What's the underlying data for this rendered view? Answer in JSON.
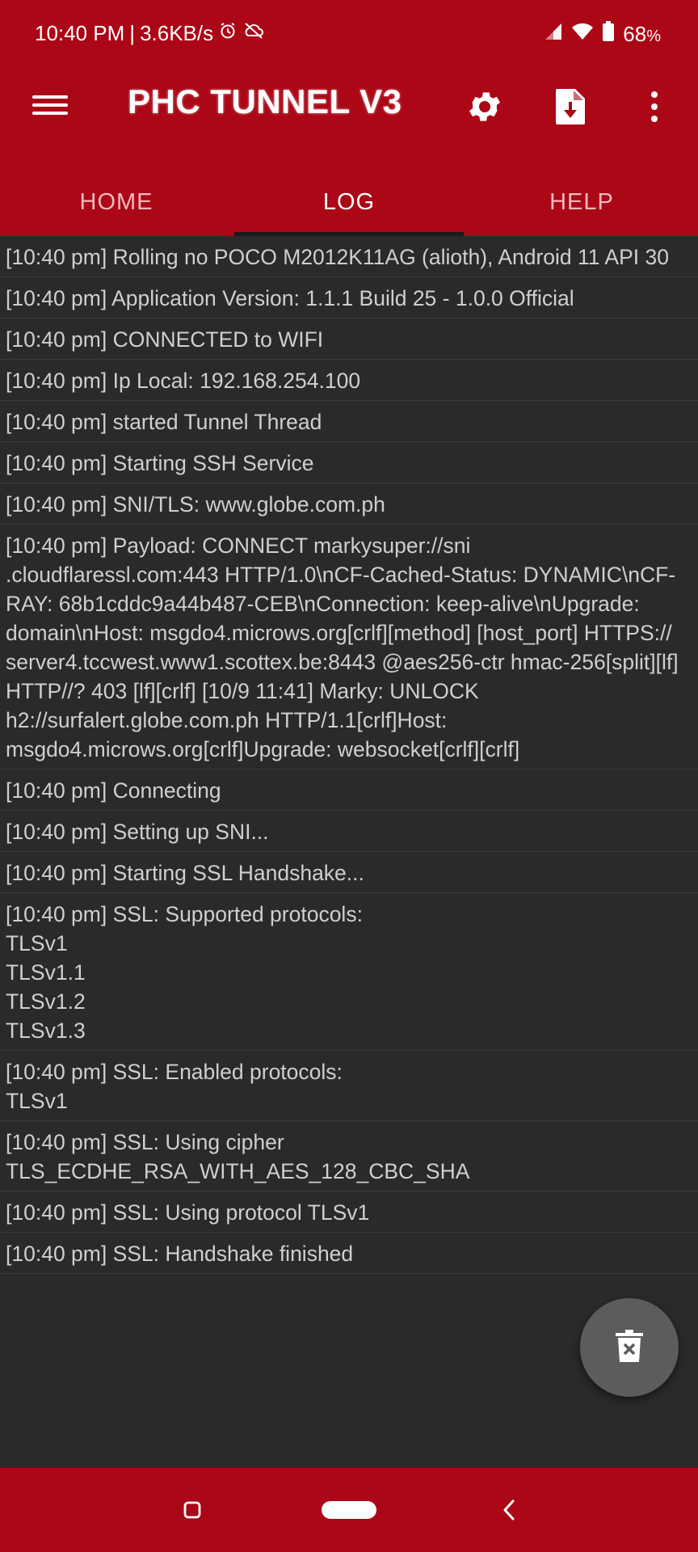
{
  "status_bar": {
    "time": "10:40 PM",
    "speed": "3.6KB/s",
    "battery": "68",
    "battery_unit": "%"
  },
  "app_bar": {
    "title": "PHC TUNNEL V3",
    "icons": [
      "menu-icon",
      "gear-icon",
      "file-import-icon",
      "more-vert-icon"
    ]
  },
  "tabs": [
    {
      "label": "HOME",
      "active": false
    },
    {
      "label": "LOG",
      "active": true
    },
    {
      "label": "HELP",
      "active": false
    }
  ],
  "log": [
    "[10:40 pm] Rolling no POCO M2012K11AG (alioth), Android 11 API 30",
    "[10:40 pm] Application Version: 1.1.1 Build 25 - 1.0.0 Official",
    "[10:40 pm] CONNECTED to WIFI",
    "[10:40 pm] Ip Local: 192.168.254.100",
    "[10:40 pm] started Tunnel Thread",
    "[10:40 pm] Starting SSH Service",
    "[10:40 pm] SNI/TLS: www.globe.com.ph",
    "[10:40 pm] Payload: CONNECT markysuper://sni\n.cloudflaressl.com:443 HTTP/1.0\\nCF-Cached-Status: DYNAMIC\\nCF-RAY: 68b1cddc9a44b487-CEB\\nConnection: keep-alive\\nUpgrade: domain\\nHost: msgdo4.microws.org[crlf][method] [host_port] HTTPS:// server4.tccwest.www1.scottex.be:8443 @aes256-ctr hmac-256[split][lf] HTTP//? 403 [lf][crlf] [10/9 11:41] Marky: UNLOCK h2://surfalert.globe.com.ph HTTP/1.1[crlf]Host: msgdo4.microws.org[crlf]Upgrade: websocket[crlf][crlf]",
    "[10:40 pm] Connecting",
    "[10:40 pm] Setting up SNI...",
    "[10:40 pm] Starting SSL Handshake...",
    "[10:40 pm] SSL: Supported protocols:\nTLSv1\nTLSv1.1\nTLSv1.2\nTLSv1.3",
    "[10:40 pm] SSL: Enabled protocols:\nTLSv1",
    "[10:40 pm] SSL: Using cipher\nTLS_ECDHE_RSA_WITH_AES_128_CBC_SHA",
    "[10:40 pm] SSL: Using protocol TLSv1",
    "[10:40 pm] SSL: Handshake finished"
  ],
  "fab": {
    "icon": "delete-icon"
  },
  "nav": {
    "icons": [
      "recents-icon",
      "home-pill-icon",
      "back-icon"
    ]
  },
  "colors": {
    "primary": "#ab0716",
    "background": "#2a2a2a",
    "text": "#cfcfcf",
    "fab": "#5c5c5c"
  }
}
